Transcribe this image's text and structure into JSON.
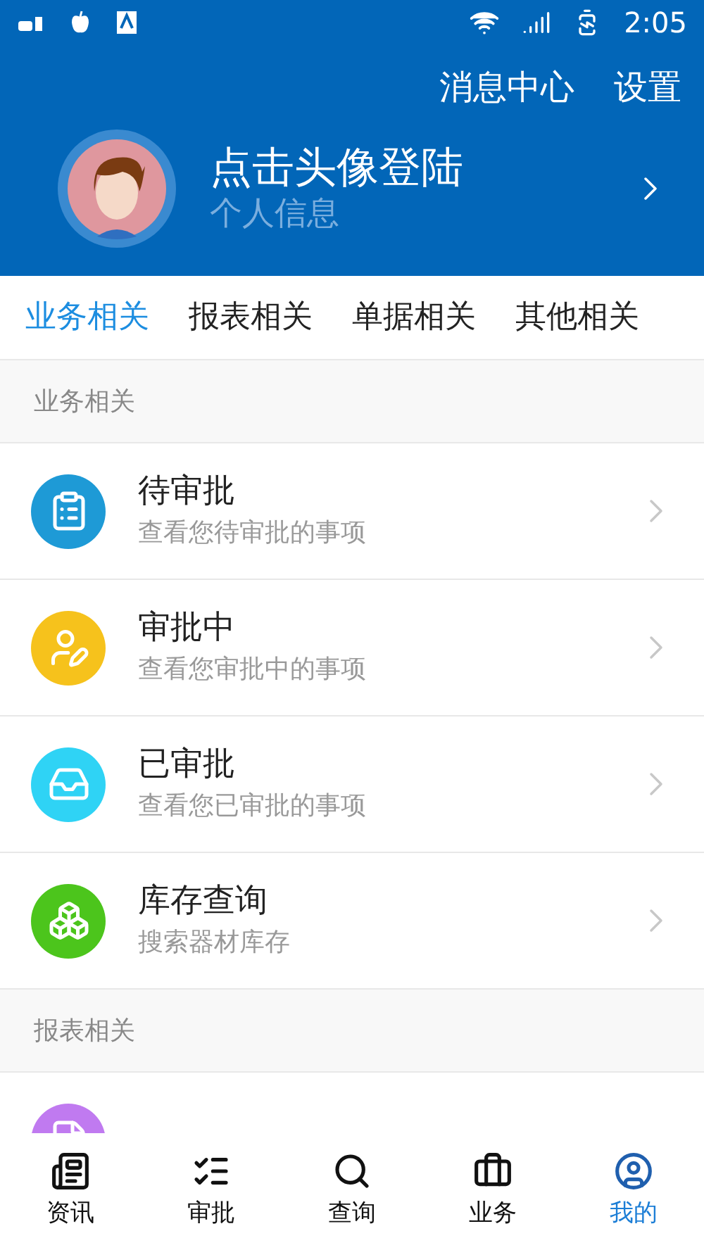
{
  "status_bar": {
    "time": "2:05"
  },
  "header": {
    "actions": [
      "消息中心",
      "设置"
    ],
    "login_title": "点击头像登陆",
    "login_subtitle": "个人信息"
  },
  "tabs": [
    {
      "label": "业务相关",
      "selected": true
    },
    {
      "label": "报表相关",
      "selected": false
    },
    {
      "label": "单据相关",
      "selected": false
    },
    {
      "label": "其他相关",
      "selected": false
    }
  ],
  "sections": [
    {
      "title": "业务相关",
      "items": [
        {
          "kind": "pending",
          "title": "待审批",
          "subtitle": "查看您待审批的事项"
        },
        {
          "kind": "in_progress",
          "title": "审批中",
          "subtitle": "查看您审批中的事项"
        },
        {
          "kind": "approved",
          "title": "已审批",
          "subtitle": "查看您已审批的事项"
        },
        {
          "kind": "stock",
          "title": "库存查询",
          "subtitle": "搜索器材库存"
        }
      ]
    },
    {
      "title": "报表相关",
      "items": [
        {
          "kind": "report"
        }
      ]
    }
  ],
  "bottom_nav": [
    {
      "kind": "news",
      "label": "资讯",
      "selected": false
    },
    {
      "kind": "approval",
      "label": "审批",
      "selected": false
    },
    {
      "kind": "search",
      "label": "查询",
      "selected": false
    },
    {
      "kind": "business",
      "label": "业务",
      "selected": false
    },
    {
      "kind": "mine",
      "label": "我的",
      "selected": true
    }
  ]
}
